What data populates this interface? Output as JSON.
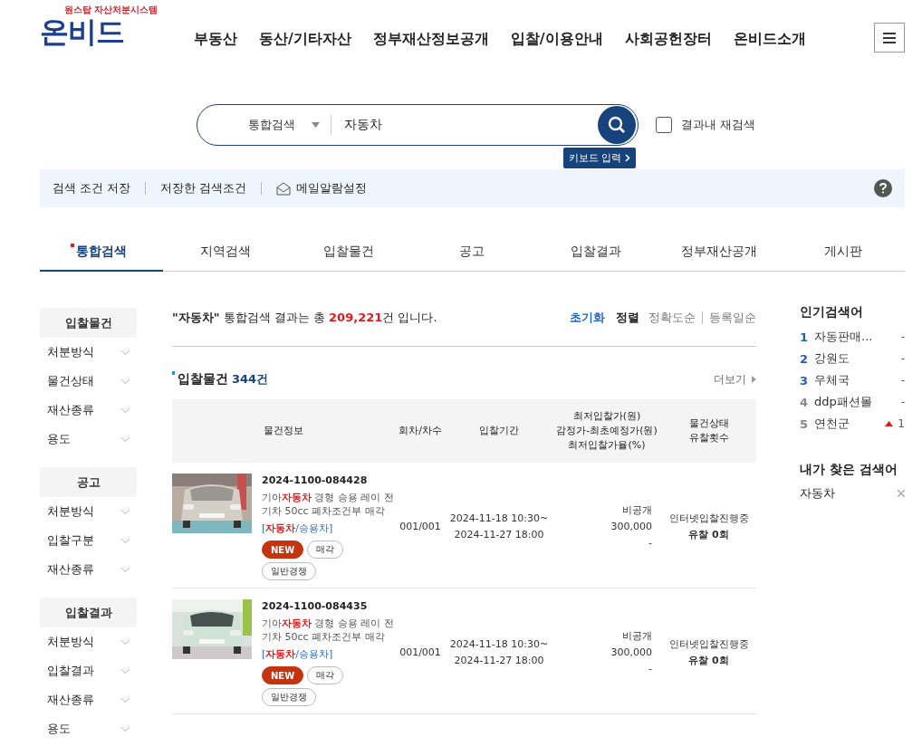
{
  "logo": {
    "tagline": "원스탑 자산처분시스템",
    "name": "온비드"
  },
  "nav": [
    "부동산",
    "동산/기타자산",
    "정부재산정보공개",
    "입찰/이용안내",
    "사회공헌장터",
    "온비드소개"
  ],
  "search": {
    "category": "통합검색",
    "value": "자동차",
    "keyboard": "키보드 입력",
    "research": {
      "label": "결과내 재검색",
      "checked": false
    }
  },
  "tools": [
    "검색 조건 저장",
    "저장한 검색조건",
    "메일알람설정"
  ],
  "tabs": [
    {
      "label": "통합검색",
      "selected": true
    },
    {
      "label": "지역검색",
      "selected": false
    },
    {
      "label": "입찰물건",
      "selected": false
    },
    {
      "label": "공고",
      "selected": false
    },
    {
      "label": "입찰결과",
      "selected": false
    },
    {
      "label": "정부재산공개",
      "selected": false
    },
    {
      "label": "게시판",
      "selected": false
    }
  ],
  "filters": [
    {
      "title": "입찰물건",
      "items": [
        "처분방식",
        "물건상태",
        "재산종류",
        "용도"
      ]
    },
    {
      "title": "공고",
      "items": [
        "처분방식",
        "입찰구분",
        "재산종류"
      ]
    },
    {
      "title": "입찰결과",
      "items": [
        "처분방식",
        "입찰결과",
        "재산종류",
        "용도"
      ]
    }
  ],
  "summary": {
    "text": "**\"자동차\"** 통합검색 결과는 총 ",
    "count": "209,221",
    "suffix": "건 입니다.",
    "reset": "초기화",
    "sort_label": "정렬",
    "sorts": [
      "정확도순",
      "등록일순"
    ]
  },
  "section": {
    "title": "입찰물건",
    "count": "344건",
    "more": "더보기"
  },
  "table": {
    "columns": [
      "물건정보",
      "회차/차수",
      "입찰기간",
      "최저입찰가(원)\n감정가-최초예정가(원)\n최저입찰가율(%)",
      "물건상태\n유찰횟수"
    ],
    "rows": [
      {
        "kind": "picture",
        "number": "2024-1100-084428",
        "description": "기아**자동차** 경형 승용 레이 전기차 50cc 폐차조건부 매각",
        "category": "[**자동차**/승용차]",
        "tags": [
          {
            "kind": "new",
            "label": "NEW"
          },
          {
            "kind": "plain",
            "label": "매각"
          },
          {
            "kind": "plain",
            "label": "일반경쟁"
          }
        ],
        "round": "001/001",
        "period": "2024-11-18 10:30~\n2024-11-27 18:00",
        "prices": [
          "비공개",
          "300,000",
          "-"
        ],
        "status": "인터넷입찰진행중",
        "failed": "유찰 0회"
      },
      {
        "kind": "picture",
        "number": "2024-1100-084435",
        "description": "기아**자동차** 경형 승용 레이 전기차 50cc 폐차조건부 매각",
        "category": "[**자동차**/승용차]",
        "tags": [
          {
            "kind": "new",
            "label": "NEW"
          },
          {
            "kind": "plain",
            "label": "매각"
          },
          {
            "kind": "plain",
            "label": "일반경쟁"
          }
        ],
        "round": "001/001",
        "period": "2024-11-18 10:30~\n2024-11-27 18:00",
        "prices": [
          "비공개",
          "300,000",
          "-"
        ],
        "status": "인터넷입찰진행중",
        "failed": "유찰 0회"
      }
    ]
  },
  "popular": {
    "title": "인기검색어",
    "items": [
      {
        "rank": "1",
        "top": true,
        "term": "자동판매...",
        "kind": "same",
        "change": "-"
      },
      {
        "rank": "2",
        "top": true,
        "term": "강원도",
        "kind": "same",
        "change": "-"
      },
      {
        "rank": "3",
        "top": true,
        "term": "우체국",
        "kind": "same",
        "change": "-"
      },
      {
        "rank": "4",
        "top": false,
        "term": "ddp패션몰",
        "kind": "same",
        "change": "-"
      },
      {
        "rank": "5",
        "top": false,
        "term": "연천군",
        "kind": "up",
        "change": "1"
      }
    ]
  },
  "recent": {
    "title": "내가 찾은 검색어",
    "items": [
      "자동차"
    ]
  }
}
